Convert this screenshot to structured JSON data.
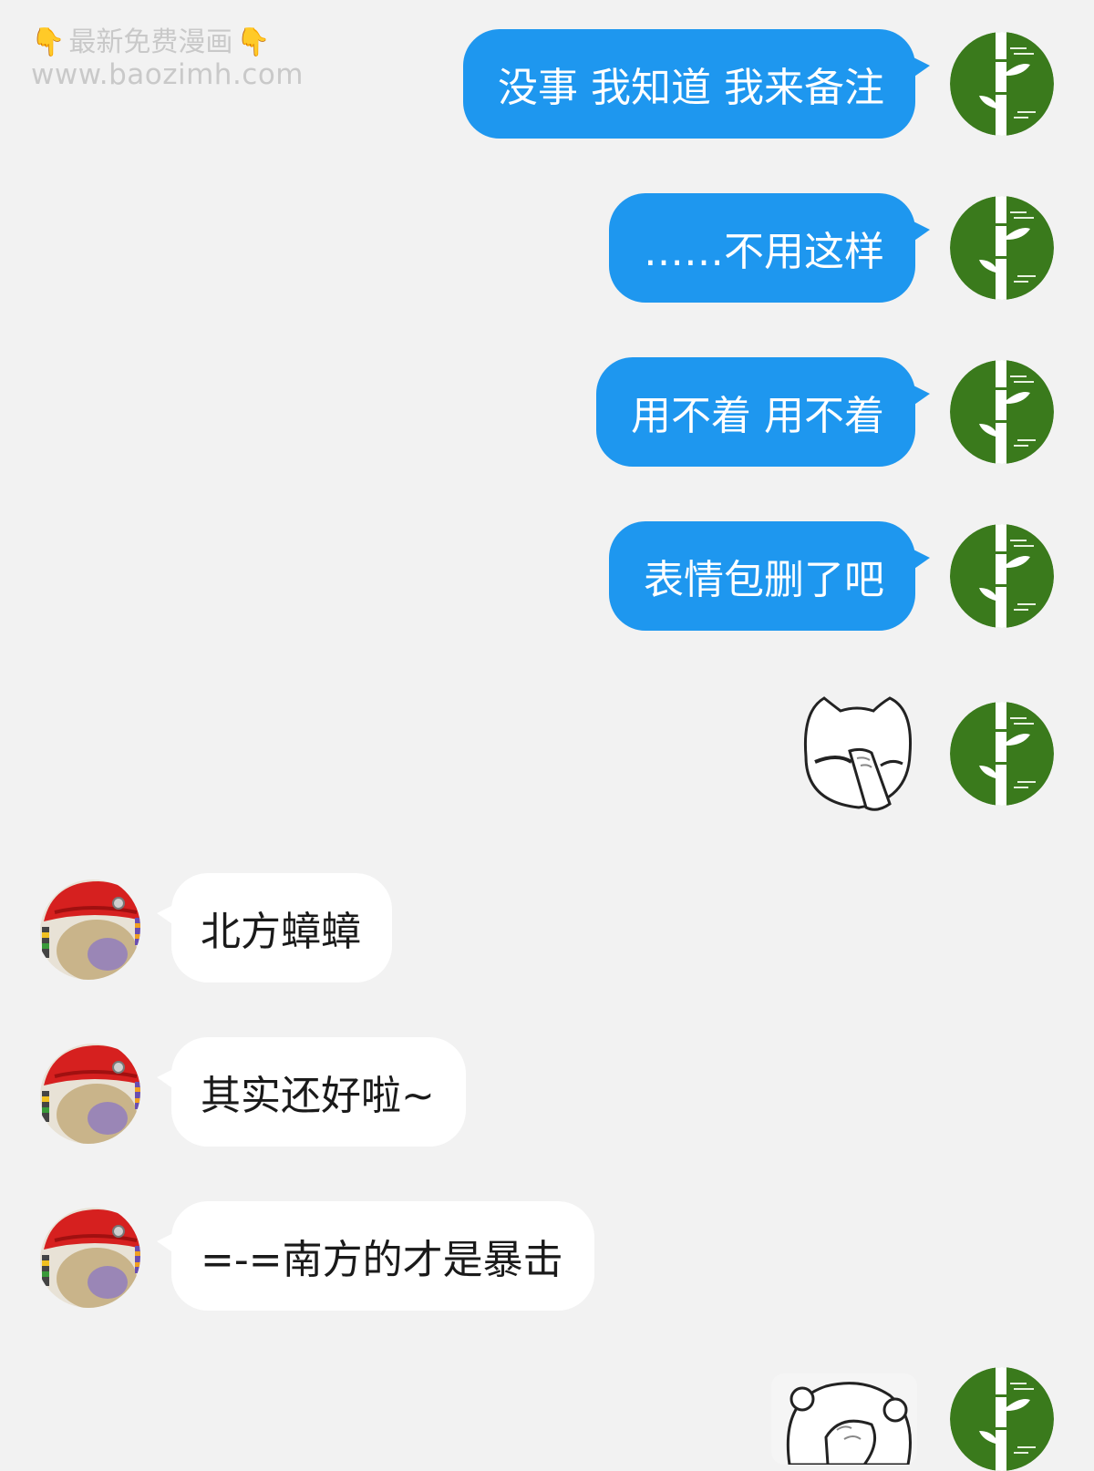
{
  "watermark": {
    "title": "最新免费漫画",
    "url": "www.baozimh.com"
  },
  "colors": {
    "background": "#f2f2f2",
    "my_bubble": "#1e97ef",
    "their_bubble": "#ffffff",
    "my_avatar": "#3a7a1c"
  },
  "conversation": [
    {
      "sender": "me",
      "text": "没事  我知道  我来备注"
    },
    {
      "sender": "me",
      "text": "……不用这样"
    },
    {
      "sender": "me",
      "text": "用不着 用不着"
    },
    {
      "sender": "me",
      "text": "表情包删了吧"
    },
    {
      "sender": "me",
      "sticker": "facepalm-cat-sticker"
    },
    {
      "sender": "them",
      "text": "北方蟑蟑"
    },
    {
      "sender": "them",
      "text": "其实还好啦~"
    },
    {
      "sender": "them",
      "text": "=-=南方的才是暴击"
    },
    {
      "sender": "me",
      "sticker": "covering-face-bear-sticker"
    }
  ]
}
